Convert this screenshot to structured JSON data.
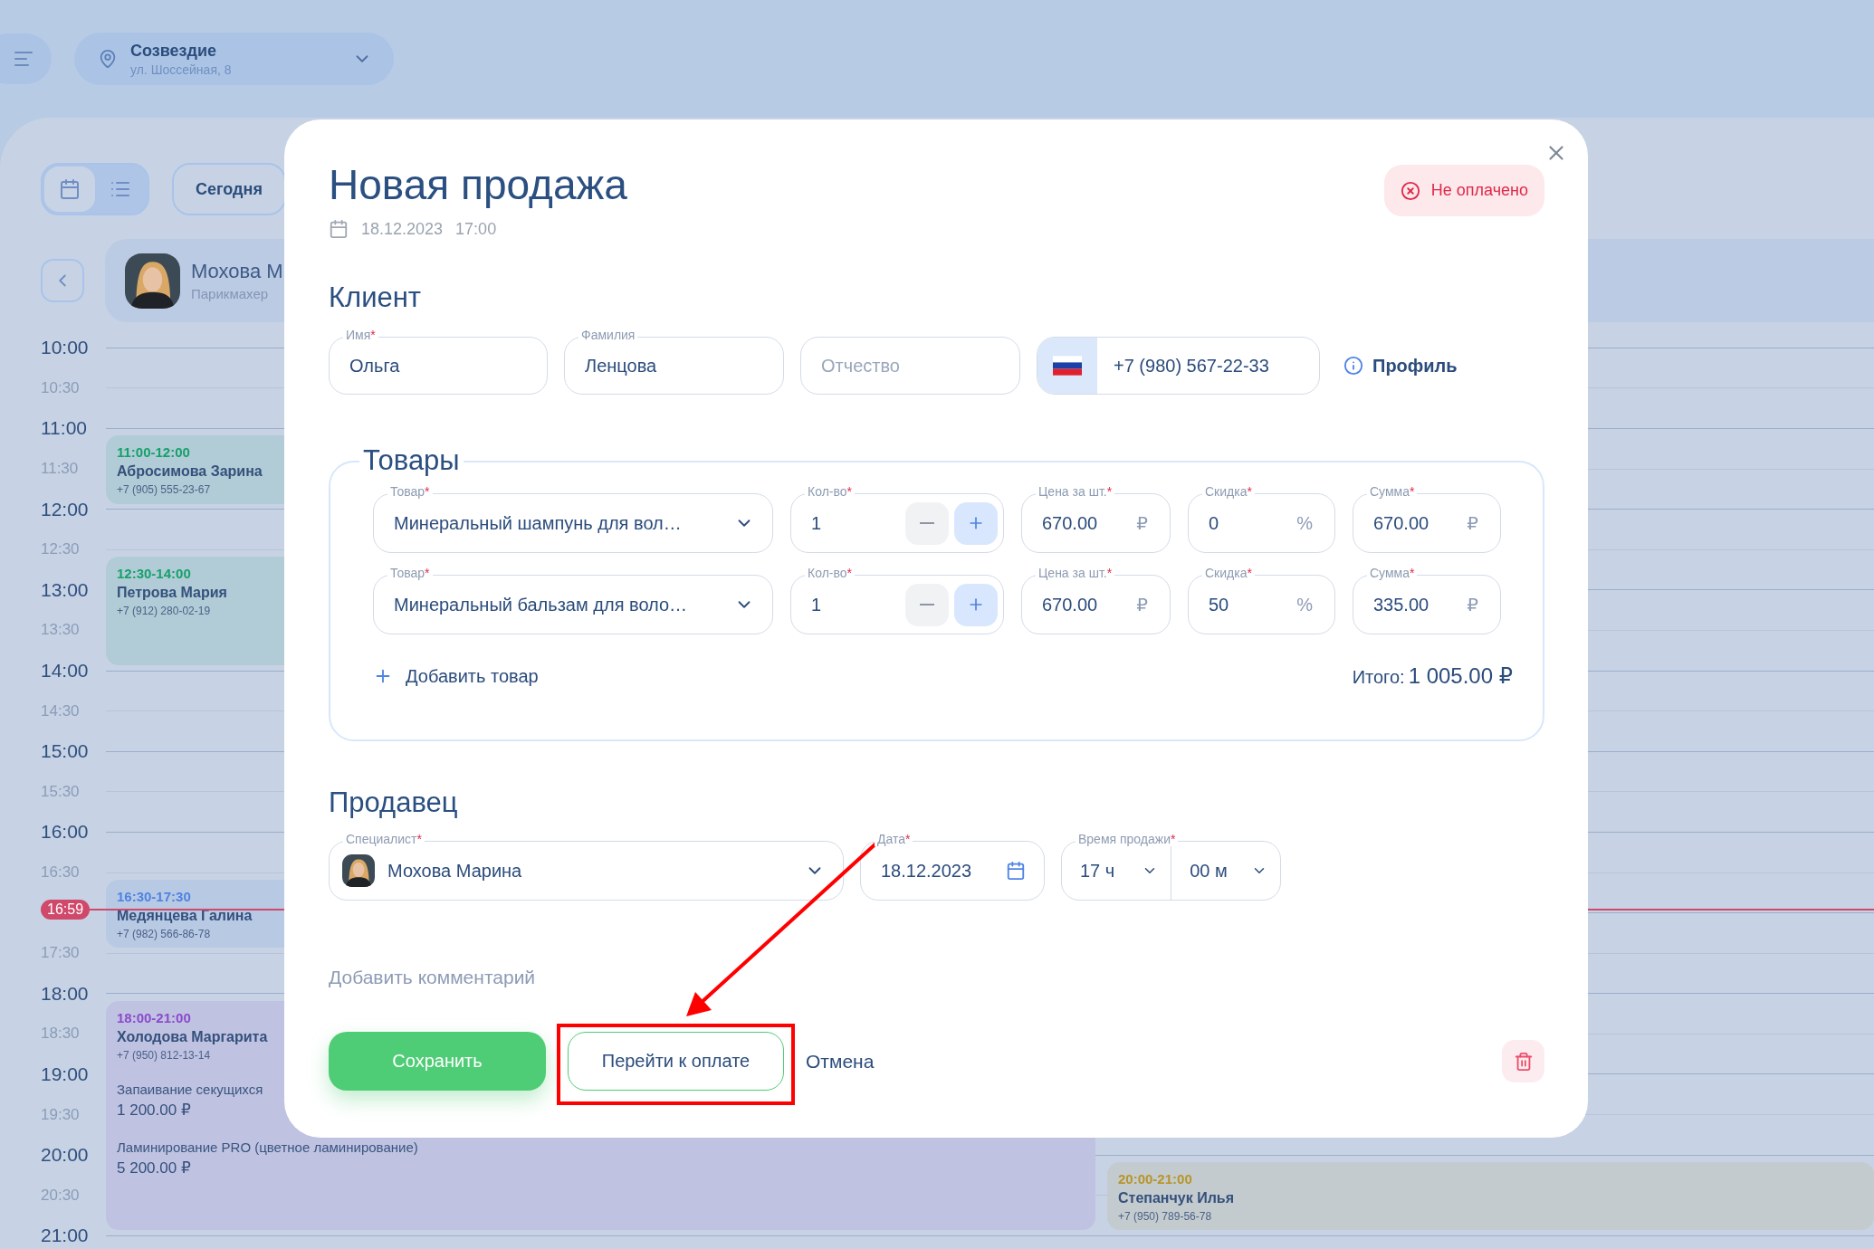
{
  "topbar": {
    "location": {
      "name": "Созвездие",
      "address": "ул. Шоссейная, 8"
    }
  },
  "toolbar": {
    "views": [
      {
        "kind": "calendar",
        "selected": true
      },
      {
        "kind": "list",
        "selected": false
      }
    ],
    "today": "Сегодня"
  },
  "columns": [
    {
      "specialist": {
        "name": "Мохова М",
        "role": "Парикмахер"
      },
      "appointments": [
        {
          "color": "#16a06c",
          "time": "11:00-12:00",
          "client": "Абросимова Зарина",
          "phone": "+7 (905) 555-23-67"
        },
        {
          "color": "#16a06c",
          "time": "12:30-14:00",
          "client": "Петрова Мария",
          "phone": "+7 (912) 280-02-19"
        },
        {
          "color": "#4f83e3",
          "time": "16:30-17:30",
          "client": "Медянцева Галина",
          "phone": "+7 (982) 566-86-78"
        },
        {
          "color": "#8c4acb",
          "time": "18:00-21:00",
          "client": "Холодова Маргарита",
          "phone": "+7 (950) 812-13-14",
          "services": [
            {
              "name": "Запаивание секущихся",
              "price": "1 200.00 ₽"
            },
            {
              "name": "Ламинирование PRO (цветное ламинирование)",
              "price": "5 200.00 ₽"
            }
          ]
        }
      ]
    },
    {
      "appointments": [
        {
          "color": "#b8952a",
          "time": "20:00-21:00",
          "client": "Степанчук Илья",
          "phone": "+7 (950) 789-56-78"
        }
      ]
    }
  ],
  "times": [
    {
      "label": "10:00",
      "kind": "hour"
    },
    {
      "label": "10:30",
      "kind": "half"
    },
    {
      "label": "11:00",
      "kind": "hour"
    },
    {
      "label": "11:30",
      "kind": "half"
    },
    {
      "label": "12:00",
      "kind": "hour"
    },
    {
      "label": "12:30",
      "kind": "half"
    },
    {
      "label": "13:00",
      "kind": "hour"
    },
    {
      "label": "13:30",
      "kind": "half"
    },
    {
      "label": "14:00",
      "kind": "hour"
    },
    {
      "label": "14:30",
      "kind": "half"
    },
    {
      "label": "15:00",
      "kind": "hour"
    },
    {
      "label": "15:30",
      "kind": "half"
    },
    {
      "label": "16:00",
      "kind": "hour"
    },
    {
      "label": "16:30",
      "kind": "half"
    },
    {
      "kind": "hour"
    },
    {
      "label": "17:30",
      "kind": "half"
    },
    {
      "label": "18:00",
      "kind": "hour"
    },
    {
      "label": "18:30",
      "kind": "half"
    },
    {
      "label": "19:00",
      "kind": "hour"
    },
    {
      "label": "19:30",
      "kind": "half"
    },
    {
      "label": "20:00",
      "kind": "hour"
    },
    {
      "label": "20:30",
      "kind": "half"
    },
    {
      "label": "21:00",
      "kind": "hour"
    }
  ],
  "now": "16:59",
  "modal": {
    "title": "Новая продажа",
    "date": "18.12.2023",
    "time": "17:00",
    "status": {
      "label": "Не оплачено",
      "paid": false
    },
    "client": {
      "heading": "Клиент",
      "fields": [
        {
          "kind": "text",
          "label": "Имя",
          "mark": "*",
          "value": "Ольга"
        },
        {
          "kind": "text",
          "label": "Фамилия",
          "value": "Ленцова"
        },
        {
          "kind": "text",
          "placeholder": "Отчество"
        },
        {
          "kind": "phone",
          "value": "+7 (980) 567-22-33"
        }
      ],
      "profile": "Профиль"
    },
    "goods": {
      "heading": "Товары",
      "rows": [
        {
          "fields": [
            {
              "kind": "select",
              "label": "Товар",
              "mark": "*",
              "value": "Минеральный шампунь для вол…"
            },
            {
              "kind": "stepper",
              "label": "Кол-во",
              "mark": "*",
              "value": "1"
            },
            {
              "kind": "amount",
              "label": "Цена за шт.",
              "mark": "*",
              "value": "670.00",
              "unit": "₽"
            },
            {
              "kind": "amount",
              "label": "Скидка",
              "mark": "*",
              "value": "0",
              "unit": "%"
            },
            {
              "kind": "amount",
              "label": "Сумма",
              "mark": "*",
              "value": "670.00",
              "unit": "₽"
            }
          ]
        },
        {
          "fields": [
            {
              "kind": "select",
              "label": "Товар",
              "mark": "*",
              "value": "Минеральный бальзам для воло…"
            },
            {
              "kind": "stepper",
              "label": "Кол-во",
              "mark": "*",
              "value": "1"
            },
            {
              "kind": "amount",
              "label": "Цена за шт.",
              "mark": "*",
              "value": "670.00",
              "unit": "₽"
            },
            {
              "kind": "amount",
              "label": "Скидка",
              "mark": "*",
              "value": "50",
              "unit": "%"
            },
            {
              "kind": "amount",
              "label": "Сумма",
              "mark": "*",
              "value": "335.00",
              "unit": "₽"
            }
          ]
        }
      ],
      "add": "Добавить товар",
      "total_label": "Итого:",
      "total": "1 005.00 ₽"
    },
    "seller": {
      "heading": "Продавец",
      "fields": [
        {
          "kind": "specialist",
          "label": "Специалист",
          "mark": "*",
          "value": "Мохова Марина"
        },
        {
          "kind": "date",
          "label": "Дата",
          "mark": "*",
          "value": "18.12.2023"
        },
        {
          "kind": "time",
          "label": "Время продажи",
          "mark": "*",
          "hours": "17 ч",
          "minutes": "00 м"
        }
      ]
    },
    "comment": "Добавить комментарий",
    "actions": {
      "save": "Сохранить",
      "pay": "Перейти к оплате",
      "cancel": "Отмена"
    }
  },
  "annotation": {
    "frame": true,
    "arrow": true
  }
}
